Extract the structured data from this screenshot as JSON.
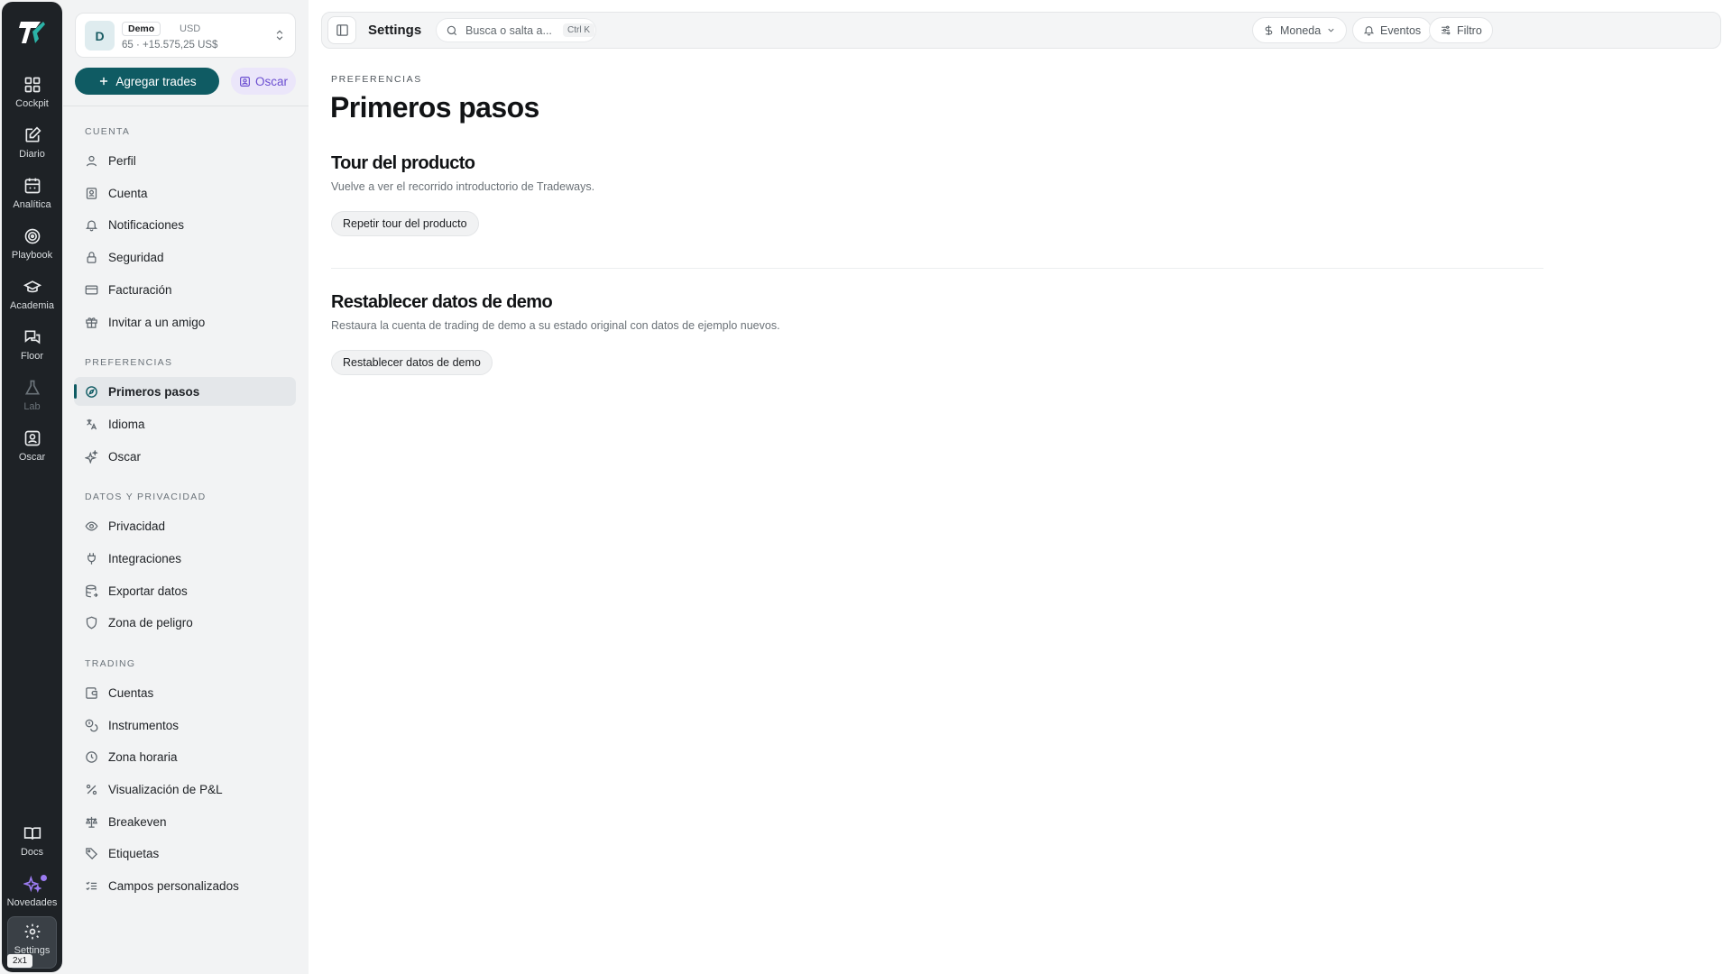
{
  "rail": {
    "items": [
      {
        "label": "Cockpit",
        "icon": "dashboard-grid-icon"
      },
      {
        "label": "Diario",
        "icon": "journal-edit-icon"
      },
      {
        "label": "Analítica",
        "icon": "calendar-analytics-icon"
      },
      {
        "label": "Playbook",
        "icon": "target-icon"
      },
      {
        "label": "Academia",
        "icon": "graduation-cap-icon"
      },
      {
        "label": "Floor",
        "icon": "chat-bubbles-icon"
      },
      {
        "label": "Lab",
        "icon": "flask-icon"
      },
      {
        "label": "Oscar",
        "icon": "oscar-portrait-icon"
      }
    ],
    "bottom": [
      {
        "label": "Docs",
        "icon": "book-open-icon"
      },
      {
        "label": "Novedades",
        "icon": "sparkles-icon"
      },
      {
        "label": "Settings",
        "icon": "gear-icon"
      }
    ],
    "zoom_badge": "2x1"
  },
  "account": {
    "avatar": "D",
    "tag": "Demo",
    "currency": "USD",
    "summary": "65 · +15.575,25 US$"
  },
  "actions": {
    "add_trades": "Agregar trades",
    "oscar": "Oscar"
  },
  "nav": {
    "sections": [
      {
        "title": "CUENTA",
        "items": [
          {
            "label": "Perfil",
            "icon": "user-icon"
          },
          {
            "label": "Cuenta",
            "icon": "id-card-icon"
          },
          {
            "label": "Notificaciones",
            "icon": "bell-icon"
          },
          {
            "label": "Seguridad",
            "icon": "lock-icon"
          },
          {
            "label": "Facturación",
            "icon": "credit-card-icon"
          },
          {
            "label": "Invitar a un amigo",
            "icon": "gift-icon"
          }
        ]
      },
      {
        "title": "PREFERENCIAS",
        "items": [
          {
            "label": "Primeros pasos",
            "icon": "compass-icon",
            "active": true
          },
          {
            "label": "Idioma",
            "icon": "translate-icon"
          },
          {
            "label": "Oscar",
            "icon": "sparkle-icon"
          }
        ]
      },
      {
        "title": "DATOS Y PRIVACIDAD",
        "items": [
          {
            "label": "Privacidad",
            "icon": "eye-icon"
          },
          {
            "label": "Integraciones",
            "icon": "plug-icon"
          },
          {
            "label": "Exportar datos",
            "icon": "database-export-icon"
          },
          {
            "label": "Zona de peligro",
            "icon": "shield-icon"
          }
        ]
      },
      {
        "title": "TRADING",
        "items": [
          {
            "label": "Cuentas",
            "icon": "wallet-icon"
          },
          {
            "label": "Instrumentos",
            "icon": "coins-icon"
          },
          {
            "label": "Zona horaria",
            "icon": "clock-icon"
          },
          {
            "label": "Visualización de P&L",
            "icon": "percent-icon"
          },
          {
            "label": "Breakeven",
            "icon": "scale-icon"
          },
          {
            "label": "Etiquetas",
            "icon": "tag-icon"
          },
          {
            "label": "Campos personalizados",
            "icon": "list-checks-icon"
          }
        ]
      }
    ]
  },
  "topbar": {
    "title": "Settings",
    "search_placeholder": "Busca o salta a...",
    "shortcut": "Ctrl K",
    "currency_label": "Moneda",
    "events_label": "Eventos",
    "filter_label": "Filtro"
  },
  "page": {
    "eyebrow": "PREFERENCIAS",
    "title": "Primeros pasos",
    "sections": [
      {
        "title": "Tour del producto",
        "description": "Vuelve a ver el recorrido introductorio de Tradeways.",
        "button": "Repetir tour del producto"
      },
      {
        "title": "Restablecer datos de demo",
        "description": "Restaura la cuenta de trading de demo a su estado original con datos de ejemplo nuevos.",
        "button": "Restablecer datos de demo"
      }
    ]
  },
  "colors": {
    "accent": "#0f5b63",
    "rail_bg": "#1e2226",
    "oscar_purple": "#6c4fd1",
    "novedades_purple": "#9b7bf0"
  }
}
